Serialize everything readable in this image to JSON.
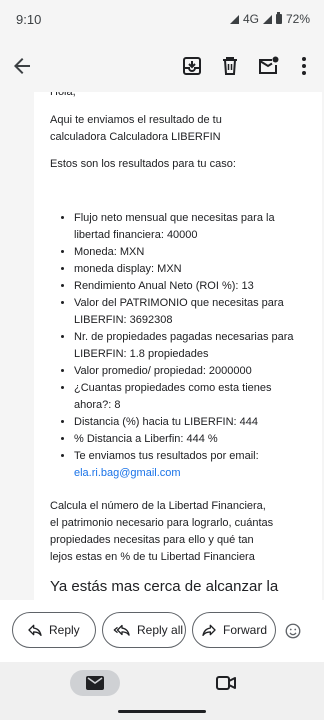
{
  "status_bar": {
    "time": "9:10",
    "network": "4G",
    "battery": "72%"
  },
  "toolbar": {
    "back_icon": "arrow-back-icon",
    "archive_icon": "archive-icon",
    "delete_icon": "trash-icon",
    "unread_icon": "mark-unread-icon",
    "more_icon": "more-vert-icon"
  },
  "email": {
    "greeting": "Hola,",
    "intro": "Aqui te enviamos el resultado de tu calculadora Calculadora LIBERFIN",
    "results_intro": "Estos son los resultados para tu caso:",
    "results": [
      "Flujo neto mensual que necesitas para la libertad financiera: 40000",
      "Moneda: MXN",
      "moneda display: MXN",
      "Rendimiento Anual Neto (ROI %): 13",
      "Valor del PATRIMONIO que necesitas para LIBERFIN: 3692308",
      "Nr. de propiedades pagadas necesarias para LIBERFIN: 1.8 propiedades",
      "Valor promedio/ propiedad: 2000000",
      "¿Cuantas propiedades como esta tienes ahora?: 8",
      "Distancia (%) hacia tu LIBERFIN: 444",
      "% Distancia a Liberfin: 444 %"
    ],
    "email_item_label": "Te enviamos tus resultados por email:",
    "email_address": "ela.ri.bag@gmail.com",
    "outro": "Calcula el número de la Libertad Financiera, el patrimonio necesario para lograrlo, cuántas propiedades necesitas para ello y qué tan lejos estas en % de tu Libertad Financiera",
    "headline": "Ya estás mas cerca de alcanzar la"
  },
  "actions": {
    "reply": "Reply",
    "reply_all": "Reply all",
    "forward": "Forward"
  },
  "colors": {
    "link": "#1a73e8",
    "background": "#f5f5f5",
    "card": "#ffffff"
  }
}
